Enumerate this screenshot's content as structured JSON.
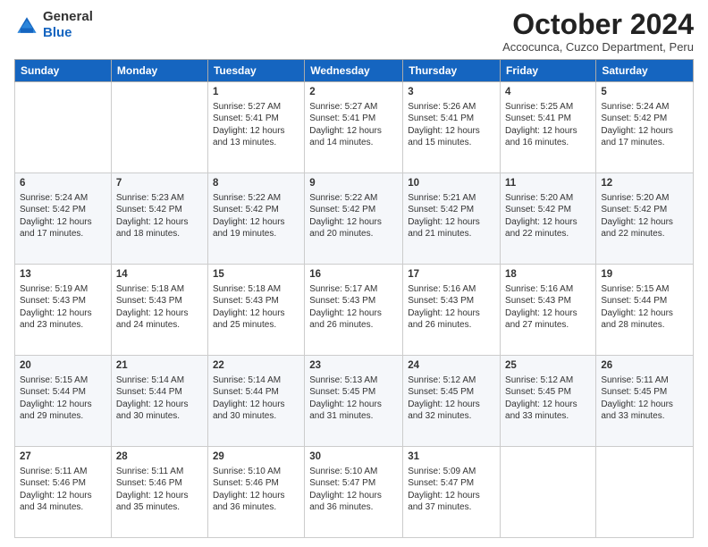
{
  "header": {
    "logo": {
      "line1": "General",
      "line2": "Blue"
    },
    "title": "October 2024",
    "subtitle": "Accocunca, Cuzco Department, Peru"
  },
  "days_of_week": [
    "Sunday",
    "Monday",
    "Tuesday",
    "Wednesday",
    "Thursday",
    "Friday",
    "Saturday"
  ],
  "weeks": [
    [
      {
        "day": "",
        "sunrise": "",
        "sunset": "",
        "daylight": ""
      },
      {
        "day": "",
        "sunrise": "",
        "sunset": "",
        "daylight": ""
      },
      {
        "day": "1",
        "sunrise": "Sunrise: 5:27 AM",
        "sunset": "Sunset: 5:41 PM",
        "daylight": "Daylight: 12 hours and 13 minutes."
      },
      {
        "day": "2",
        "sunrise": "Sunrise: 5:27 AM",
        "sunset": "Sunset: 5:41 PM",
        "daylight": "Daylight: 12 hours and 14 minutes."
      },
      {
        "day": "3",
        "sunrise": "Sunrise: 5:26 AM",
        "sunset": "Sunset: 5:41 PM",
        "daylight": "Daylight: 12 hours and 15 minutes."
      },
      {
        "day": "4",
        "sunrise": "Sunrise: 5:25 AM",
        "sunset": "Sunset: 5:41 PM",
        "daylight": "Daylight: 12 hours and 16 minutes."
      },
      {
        "day": "5",
        "sunrise": "Sunrise: 5:24 AM",
        "sunset": "Sunset: 5:42 PM",
        "daylight": "Daylight: 12 hours and 17 minutes."
      }
    ],
    [
      {
        "day": "6",
        "sunrise": "Sunrise: 5:24 AM",
        "sunset": "Sunset: 5:42 PM",
        "daylight": "Daylight: 12 hours and 17 minutes."
      },
      {
        "day": "7",
        "sunrise": "Sunrise: 5:23 AM",
        "sunset": "Sunset: 5:42 PM",
        "daylight": "Daylight: 12 hours and 18 minutes."
      },
      {
        "day": "8",
        "sunrise": "Sunrise: 5:22 AM",
        "sunset": "Sunset: 5:42 PM",
        "daylight": "Daylight: 12 hours and 19 minutes."
      },
      {
        "day": "9",
        "sunrise": "Sunrise: 5:22 AM",
        "sunset": "Sunset: 5:42 PM",
        "daylight": "Daylight: 12 hours and 20 minutes."
      },
      {
        "day": "10",
        "sunrise": "Sunrise: 5:21 AM",
        "sunset": "Sunset: 5:42 PM",
        "daylight": "Daylight: 12 hours and 21 minutes."
      },
      {
        "day": "11",
        "sunrise": "Sunrise: 5:20 AM",
        "sunset": "Sunset: 5:42 PM",
        "daylight": "Daylight: 12 hours and 22 minutes."
      },
      {
        "day": "12",
        "sunrise": "Sunrise: 5:20 AM",
        "sunset": "Sunset: 5:42 PM",
        "daylight": "Daylight: 12 hours and 22 minutes."
      }
    ],
    [
      {
        "day": "13",
        "sunrise": "Sunrise: 5:19 AM",
        "sunset": "Sunset: 5:43 PM",
        "daylight": "Daylight: 12 hours and 23 minutes."
      },
      {
        "day": "14",
        "sunrise": "Sunrise: 5:18 AM",
        "sunset": "Sunset: 5:43 PM",
        "daylight": "Daylight: 12 hours and 24 minutes."
      },
      {
        "day": "15",
        "sunrise": "Sunrise: 5:18 AM",
        "sunset": "Sunset: 5:43 PM",
        "daylight": "Daylight: 12 hours and 25 minutes."
      },
      {
        "day": "16",
        "sunrise": "Sunrise: 5:17 AM",
        "sunset": "Sunset: 5:43 PM",
        "daylight": "Daylight: 12 hours and 26 minutes."
      },
      {
        "day": "17",
        "sunrise": "Sunrise: 5:16 AM",
        "sunset": "Sunset: 5:43 PM",
        "daylight": "Daylight: 12 hours and 26 minutes."
      },
      {
        "day": "18",
        "sunrise": "Sunrise: 5:16 AM",
        "sunset": "Sunset: 5:43 PM",
        "daylight": "Daylight: 12 hours and 27 minutes."
      },
      {
        "day": "19",
        "sunrise": "Sunrise: 5:15 AM",
        "sunset": "Sunset: 5:44 PM",
        "daylight": "Daylight: 12 hours and 28 minutes."
      }
    ],
    [
      {
        "day": "20",
        "sunrise": "Sunrise: 5:15 AM",
        "sunset": "Sunset: 5:44 PM",
        "daylight": "Daylight: 12 hours and 29 minutes."
      },
      {
        "day": "21",
        "sunrise": "Sunrise: 5:14 AM",
        "sunset": "Sunset: 5:44 PM",
        "daylight": "Daylight: 12 hours and 30 minutes."
      },
      {
        "day": "22",
        "sunrise": "Sunrise: 5:14 AM",
        "sunset": "Sunset: 5:44 PM",
        "daylight": "Daylight: 12 hours and 30 minutes."
      },
      {
        "day": "23",
        "sunrise": "Sunrise: 5:13 AM",
        "sunset": "Sunset: 5:45 PM",
        "daylight": "Daylight: 12 hours and 31 minutes."
      },
      {
        "day": "24",
        "sunrise": "Sunrise: 5:12 AM",
        "sunset": "Sunset: 5:45 PM",
        "daylight": "Daylight: 12 hours and 32 minutes."
      },
      {
        "day": "25",
        "sunrise": "Sunrise: 5:12 AM",
        "sunset": "Sunset: 5:45 PM",
        "daylight": "Daylight: 12 hours and 33 minutes."
      },
      {
        "day": "26",
        "sunrise": "Sunrise: 5:11 AM",
        "sunset": "Sunset: 5:45 PM",
        "daylight": "Daylight: 12 hours and 33 minutes."
      }
    ],
    [
      {
        "day": "27",
        "sunrise": "Sunrise: 5:11 AM",
        "sunset": "Sunset: 5:46 PM",
        "daylight": "Daylight: 12 hours and 34 minutes."
      },
      {
        "day": "28",
        "sunrise": "Sunrise: 5:11 AM",
        "sunset": "Sunset: 5:46 PM",
        "daylight": "Daylight: 12 hours and 35 minutes."
      },
      {
        "day": "29",
        "sunrise": "Sunrise: 5:10 AM",
        "sunset": "Sunset: 5:46 PM",
        "daylight": "Daylight: 12 hours and 36 minutes."
      },
      {
        "day": "30",
        "sunrise": "Sunrise: 5:10 AM",
        "sunset": "Sunset: 5:47 PM",
        "daylight": "Daylight: 12 hours and 36 minutes."
      },
      {
        "day": "31",
        "sunrise": "Sunrise: 5:09 AM",
        "sunset": "Sunset: 5:47 PM",
        "daylight": "Daylight: 12 hours and 37 minutes."
      },
      {
        "day": "",
        "sunrise": "",
        "sunset": "",
        "daylight": ""
      },
      {
        "day": "",
        "sunrise": "",
        "sunset": "",
        "daylight": ""
      }
    ]
  ]
}
